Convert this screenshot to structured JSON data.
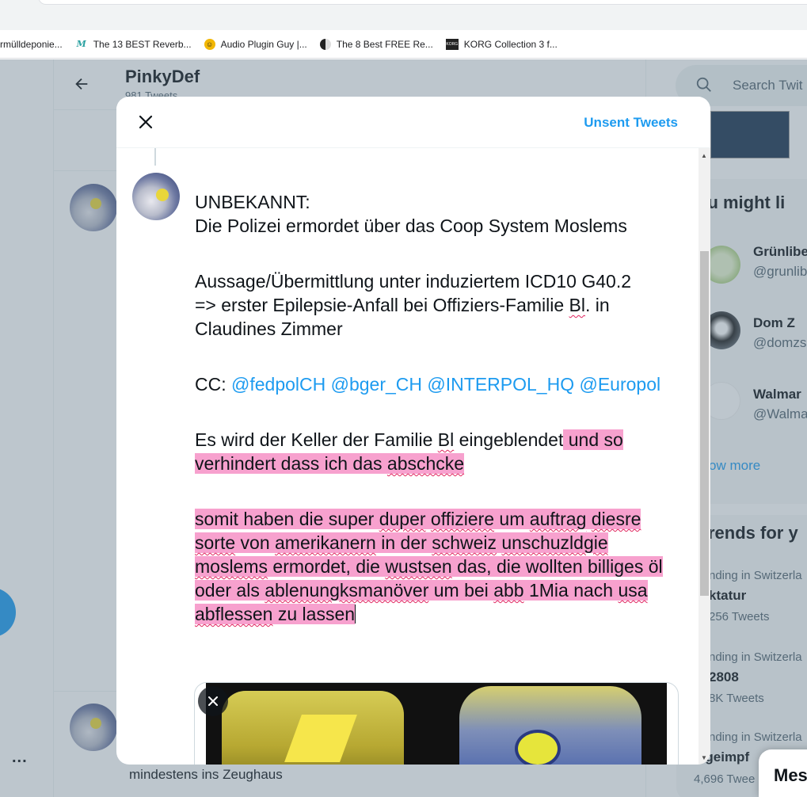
{
  "bookmarks": [
    {
      "label": "rmülldeponie...",
      "icon": "page-icon"
    },
    {
      "label": "The 13 BEST Reverb...",
      "icon": "m-logo-icon"
    },
    {
      "label": "Audio Plugin Guy |...",
      "icon": "apg-logo-icon"
    },
    {
      "label": "The 8 Best FREE Re...",
      "icon": "half-circle-logo-icon"
    },
    {
      "label": "KORG Collection 3 f...",
      "icon": "korg-logo-icon"
    }
  ],
  "profile": {
    "name": "PinkyDef",
    "tweet_count": "981 Tweets"
  },
  "feed": {
    "second_tweet_snippet": "mindestens ins Zeughaus",
    "more": "..."
  },
  "sidebar": {
    "search_placeholder": "Search Twit",
    "might_like_heading": "ou might li",
    "accounts": [
      {
        "name": "Grünlibe",
        "handle": "@grunlib"
      },
      {
        "name": "Dom Z",
        "handle": "@domzs"
      },
      {
        "name": "Walmar",
        "handle": "@Walma"
      }
    ],
    "show_more": "ow more",
    "trends_heading": "rends for y",
    "trends": [
      {
        "context": "nding in Switzerla",
        "topic": "ktatur",
        "count": "256 Tweets"
      },
      {
        "context": "nding in Switzerla",
        "topic": "2808",
        "count": "8K Tweets"
      },
      {
        "context": "nding in Switzerla",
        "topic": "ngeimpf",
        "count": "4,696 Twee"
      }
    ],
    "messages": "Mes"
  },
  "modal": {
    "unsent_label": "Unsent Tweets",
    "lines": {
      "l1": "UNBEKANNT:",
      "l2": "Die Polizei ermordet über das Coop System Moslems",
      "l3": "Aussage/Übermittlung unter induziertem ICD10 G40.2",
      "l4a": "=> erster Epilepsie-Anfall bei Offiziers-Familie ",
      "l4b": "Bl",
      "l4c": ". in",
      "l5": "Claudines Zimmer",
      "cc": "CC: ",
      "mentions": [
        "@fedpolCH",
        "@bger_CH",
        "@INTERPOL_HQ",
        "@Europol"
      ],
      "p4a": "Es wird der Keller der Familie ",
      "p4b": "Bl",
      "p4c": " eingeblendet",
      "p4d": " und so",
      "p4e": "verhindert dass ich das ",
      "p4f": "abschcke",
      "p5": [
        {
          "t": "somit haben die super ",
          "sq": false
        },
        {
          "t": "duper",
          "sq": true
        },
        {
          "t": " ",
          "sq": false
        },
        {
          "t": "offiziere",
          "sq": true
        },
        {
          "t": " um ",
          "sq": false
        },
        {
          "t": "auftrag",
          "sq": true
        },
        {
          "t": " ",
          "sq": false
        },
        {
          "t": "diesre",
          "sq": true
        },
        {
          "t": " ",
          "sq": false
        },
        {
          "t": "sorte",
          "sq": true
        },
        {
          "t": " von ",
          "sq": false
        },
        {
          "t": "amerikanern",
          "sq": true
        },
        {
          "t": " in der ",
          "sq": false
        },
        {
          "t": "schweiz",
          "sq": true
        },
        {
          "t": " ",
          "sq": false
        },
        {
          "t": "unschuzldgie",
          "sq": true
        },
        {
          "t": " ",
          "sq": false
        },
        {
          "t": "moslems",
          "sq": true
        },
        {
          "t": " ermordet, die ",
          "sq": false
        },
        {
          "t": "wustsen",
          "sq": true
        },
        {
          "t": " das, die wollten billiges öl oder als ",
          "sq": false
        },
        {
          "t": "ablenungksmanöver",
          "sq": true
        },
        {
          "t": " um bei ",
          "sq": false
        },
        {
          "t": "abb",
          "sq": true
        },
        {
          "t": " 1Mia nach ",
          "sq": false
        },
        {
          "t": "usa",
          "sq": true
        },
        {
          "t": " ",
          "sq": false
        },
        {
          "t": "abflessen",
          "sq": true
        },
        {
          "t": " zu lassen",
          "sq": false
        }
      ]
    }
  },
  "colors": {
    "accent": "#1d9bf0",
    "highlight": "#f7a1ce",
    "spell": "#e0245e"
  }
}
